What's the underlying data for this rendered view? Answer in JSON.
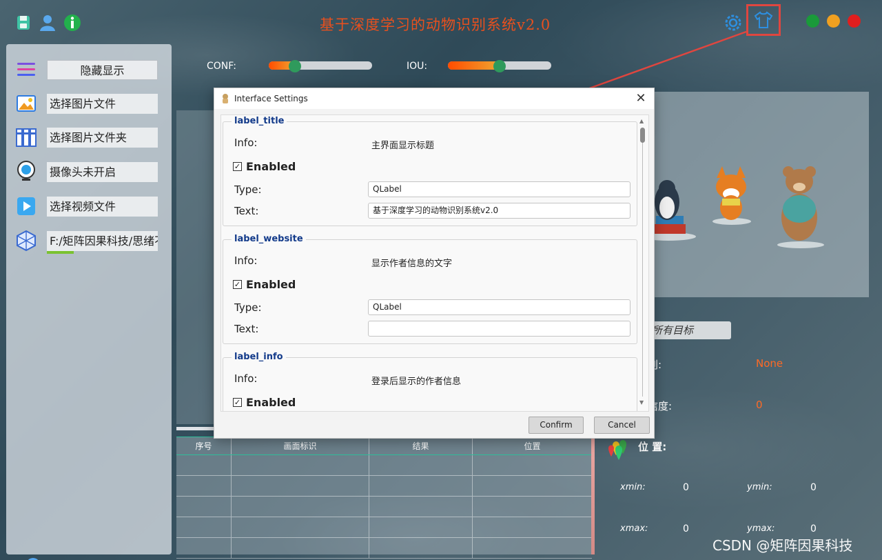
{
  "header": {
    "title": "基于深度学习的动物识别系统v2.0",
    "icons": [
      "save-icon",
      "user-icon",
      "info-icon",
      "settings-gear-icon",
      "theme-shirt-icon"
    ],
    "window_buttons": [
      {
        "name": "maximize",
        "color": "#1a9a3a"
      },
      {
        "name": "minimize",
        "color": "#f0a020"
      },
      {
        "name": "close",
        "color": "#e01e1e"
      }
    ]
  },
  "sidebar": {
    "items": [
      {
        "icon": "menu-icon",
        "label": "隐藏显示"
      },
      {
        "icon": "image-icon",
        "label": "选择图片文件"
      },
      {
        "icon": "folder-icon",
        "label": "选择图片文件夹"
      },
      {
        "icon": "camera-icon",
        "label": "摄像头未开启"
      },
      {
        "icon": "video-icon",
        "label": "选择视频文件"
      },
      {
        "icon": "model-icon",
        "label": "F:/矩阵因果科技/思绪不"
      }
    ],
    "model_load_progress": 0.24
  },
  "sliders": {
    "conf": {
      "label": "CONF:",
      "value": 0.25
    },
    "iou": {
      "label": "IOU:",
      "value": 0.5
    }
  },
  "results": {
    "target_combo": "所有目标",
    "class_label": "别:",
    "class_value": "None",
    "conf_label": "信度:",
    "conf_value": "0",
    "position_label": "位 置:",
    "xmin_label": "xmin:",
    "xmin": "0",
    "ymin_label": "ymin:",
    "ymin": "0",
    "xmax_label": "xmax:",
    "xmax": "0",
    "ymax_label": "ymax:",
    "ymax": "0"
  },
  "table": {
    "headers": [
      "序号",
      "画面标识",
      "结果",
      "位置"
    ],
    "rows": 5
  },
  "watermark": "CSDN @矩阵因果科技",
  "dialog": {
    "title": "Interface Settings",
    "groups": [
      {
        "name": "label_title",
        "info_label": "Info:",
        "info": "主界面显示标题",
        "enabled_label": "Enabled",
        "enabled": true,
        "type_label": "Type:",
        "type": "QLabel",
        "text_label": "Text:",
        "text": "基于深度学习的动物识别系统v2.0"
      },
      {
        "name": "label_website",
        "info_label": "Info:",
        "info": "显示作者信息的文字",
        "enabled_label": "Enabled",
        "enabled": true,
        "type_label": "Type:",
        "type": "QLabel",
        "text_label": "Text:",
        "text": ""
      },
      {
        "name": "label_info",
        "info_label": "Info:",
        "info": "登录后显示的作者信息",
        "enabled_label": "Enabled",
        "enabled": true
      }
    ],
    "confirm_label": "Confirm",
    "cancel_label": "Cancel"
  }
}
